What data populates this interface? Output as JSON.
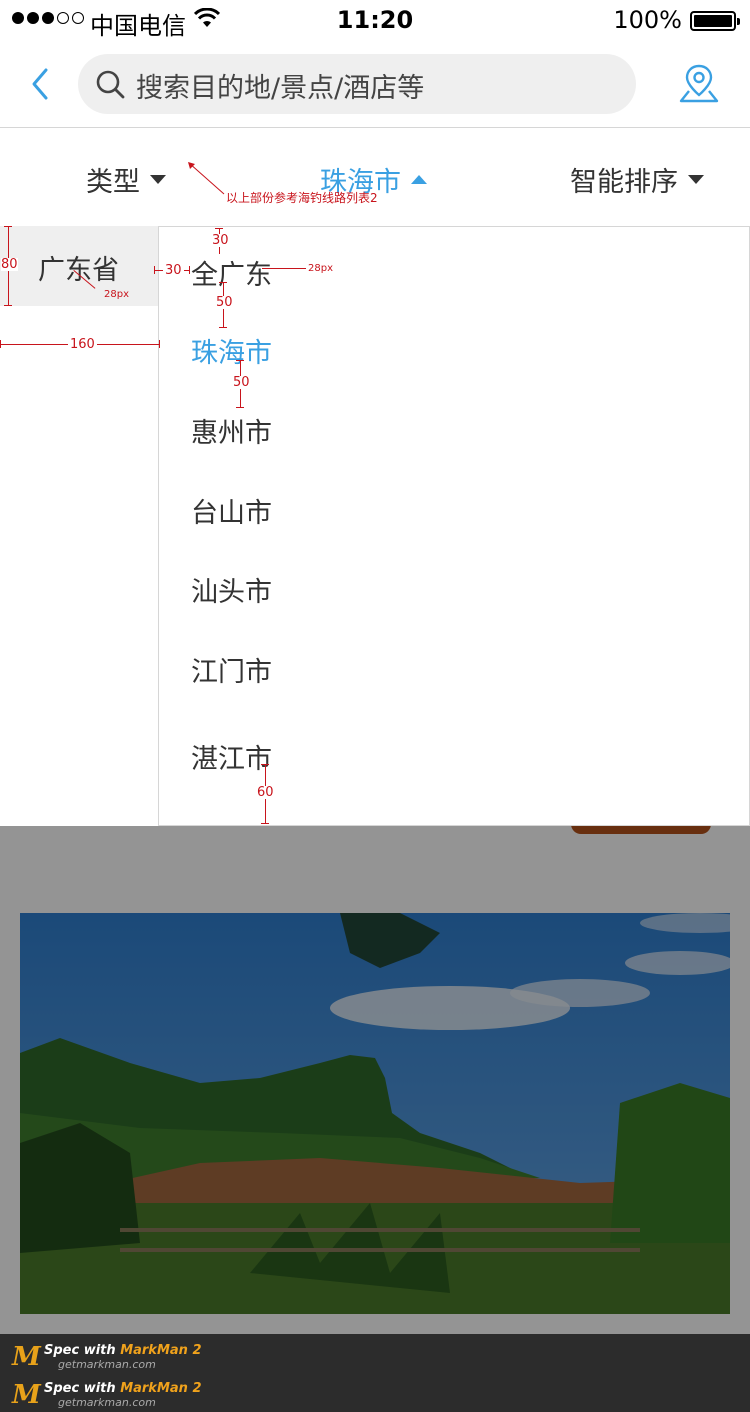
{
  "status_bar": {
    "carrier": "中国电信",
    "time": "11:20",
    "battery": "100%",
    "signal_bars_filled": 3,
    "signal_bars_total": 5
  },
  "nav": {
    "search_placeholder": "搜索目的地/景点/酒店等"
  },
  "tabs": {
    "type_label": "类型",
    "city_label": "珠海市",
    "sort_label": "智能排序"
  },
  "dropdown": {
    "province": "广东省",
    "cities": [
      "全广东",
      "珠海市",
      "惠州市",
      "台山市",
      "汕头市",
      "江门市",
      "湛江市"
    ],
    "selected_city": "珠海市"
  },
  "annotations": {
    "note": "以上部份参考海钓线路列表2",
    "m30_top": "30",
    "m28_city": "28px",
    "m80": "80",
    "m30_left": "30",
    "m28_prov": "28px",
    "m50_a": "50",
    "m160": "160",
    "m50_b": "50",
    "m60": "60"
  },
  "footer": {
    "badges": [
      {
        "line1_prefix": "Spec with ",
        "line1_brand": "MarkMan 2",
        "line2": "getmarkman.com"
      },
      {
        "line1_prefix": "Spec with ",
        "line1_brand": "MarkMan 2",
        "line2": "getmarkman.com"
      }
    ]
  },
  "colors": {
    "accent": "#3aa0e2",
    "spec_red": "#c8141c",
    "orange": "#b3521a"
  }
}
